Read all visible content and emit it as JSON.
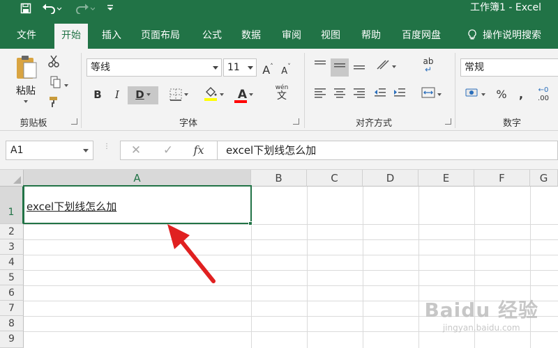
{
  "titlebar": {
    "title": "工作簿1  -  Excel"
  },
  "tabs": [
    "文件",
    "开始",
    "插入",
    "页面布局",
    "公式",
    "数据",
    "审阅",
    "视图",
    "帮助",
    "百度网盘",
    "操作说明搜索"
  ],
  "ribbon": {
    "paste_label": "粘贴",
    "group_clipboard": "剪贴板",
    "font_name": "等线",
    "font_size": "11",
    "bold": "B",
    "italic": "I",
    "underline": "D",
    "font_color_letter": "A",
    "wen_label": "wén",
    "wen_char": "文",
    "group_font": "字体",
    "group_alignment": "对齐方式",
    "number_format": "常规",
    "percent": "%",
    "comma": ",",
    "group_number": "数字",
    "ab_label": "ab",
    "highlight_color": "#ffff00",
    "font_color": "#ff0000"
  },
  "formulabar": {
    "name_box": "A1",
    "cancel": "✕",
    "enter": "✓",
    "fx": "fx",
    "formula": "excel下划线怎么加"
  },
  "grid": {
    "columns": [
      "A",
      "B",
      "C",
      "D",
      "E",
      "F",
      "G"
    ],
    "rows": [
      "1",
      "2",
      "3",
      "4",
      "5",
      "6",
      "7",
      "8",
      "9"
    ],
    "cell_a1": "excel下划线怎么加"
  },
  "watermark": {
    "big": "Baidu 经验",
    "small": "jingyan.baidu.com"
  },
  "colors": {
    "brand": "#217346",
    "arrow": "#e02020"
  }
}
